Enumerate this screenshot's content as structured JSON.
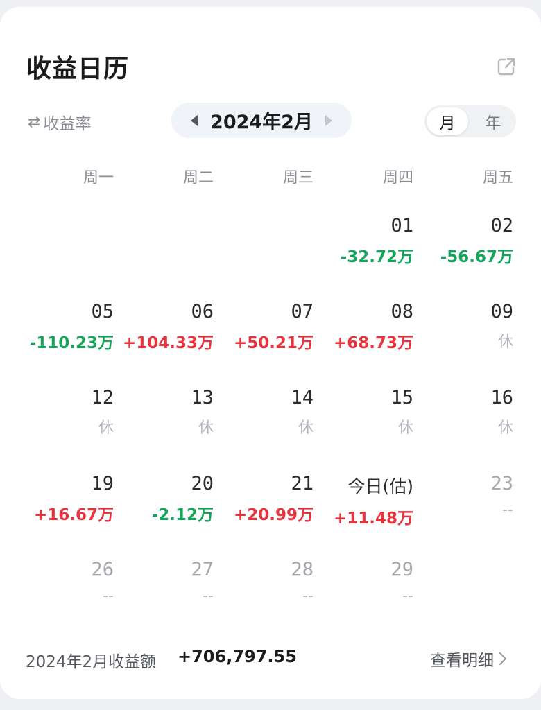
{
  "header": {
    "title": "收益日历",
    "share_icon": "external-link-icon"
  },
  "controls": {
    "rate_toggle_label": "收益率",
    "swap_icon": "⇄",
    "month_label": "2024年2月",
    "segments": [
      "月",
      "年"
    ],
    "active_segment": "月"
  },
  "weekdays": [
    "周一",
    "周二",
    "周三",
    "周四",
    "周五"
  ],
  "days": [
    {
      "day": "01",
      "value": "-32.72万",
      "type": "neg"
    },
    {
      "day": "02",
      "value": "-56.67万",
      "type": "neg"
    },
    {
      "day": "05",
      "value": "-110.23万",
      "type": "neg"
    },
    {
      "day": "06",
      "value": "+104.33万",
      "type": "pos"
    },
    {
      "day": "07",
      "value": "+50.21万",
      "type": "pos"
    },
    {
      "day": "08",
      "value": "+68.73万",
      "type": "pos"
    },
    {
      "day": "09",
      "value": "休",
      "type": "rest"
    },
    {
      "day": "12",
      "value": "休",
      "type": "rest"
    },
    {
      "day": "13",
      "value": "休",
      "type": "rest"
    },
    {
      "day": "14",
      "value": "休",
      "type": "rest"
    },
    {
      "day": "15",
      "value": "休",
      "type": "rest"
    },
    {
      "day": "16",
      "value": "休",
      "type": "rest"
    },
    {
      "day": "19",
      "value": "+16.67万",
      "type": "pos"
    },
    {
      "day": "20",
      "value": "-2.12万",
      "type": "neg"
    },
    {
      "day": "21",
      "value": "+20.99万",
      "type": "pos"
    },
    {
      "day": "今日(估)",
      "value": "+11.48万",
      "type": "pos"
    },
    {
      "day": "23",
      "value": "--",
      "type": "none"
    },
    {
      "day": "26",
      "value": "--",
      "type": "none"
    },
    {
      "day": "27",
      "value": "--",
      "type": "none"
    },
    {
      "day": "28",
      "value": "--",
      "type": "none"
    },
    {
      "day": "29",
      "value": "--",
      "type": "none"
    }
  ],
  "footer": {
    "label": "2024年2月收益额",
    "total": "+706,797.55",
    "detail_label": "查看明细"
  },
  "colors": {
    "positive": "#e8323c",
    "negative": "#14a55a",
    "muted": "#b5b7bc"
  }
}
